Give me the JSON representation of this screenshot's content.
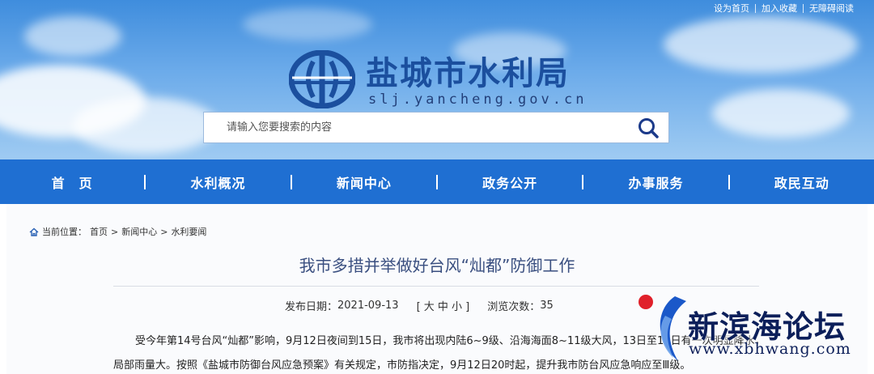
{
  "top_links": [
    "设为首页",
    "加入收藏",
    "无障碍阅读"
  ],
  "site": {
    "title": "盐城市水利局",
    "domain": "slj.yancheng.gov.cn"
  },
  "search": {
    "placeholder": "请输入您要搜索的内容",
    "icon": "search-icon"
  },
  "nav": {
    "items": [
      "首　页",
      "水利概况",
      "新闻中心",
      "政务公开",
      "办事服务",
      "政民互动"
    ]
  },
  "breadcrumb": {
    "prefix": "当前位置：",
    "items": [
      "首页",
      "新闻中心",
      "水利要闻"
    ],
    "separator": ">",
    "icon": "home-icon"
  },
  "article": {
    "title": "我市多措并举做好台风“灿都”防御工作",
    "publish_label": "发布日期：",
    "publish_date": "2021-09-13",
    "font_size_control": "[ 大 中 小 ]",
    "views_label": "浏览次数：",
    "views": "35",
    "paragraph_1": "受今年第14号台风“灿都”影响，9月12日夜间到15日，我市将出现内陆6~9级、沿海海面8~11级大风，13日至15日有一次明显降水，",
    "paragraph_2": "局部雨量大。按照《盐城市防御台风应急预案》有关规定，市防指决定，9月12日20时起，提升我市防台风应急响应至Ⅲ级。"
  },
  "watermark": {
    "name": "新滨海论坛",
    "url": "www.xbhwang.com"
  },
  "colors": {
    "nav_bg": "#1f6fd2",
    "title_blue": "#1b4f9e",
    "article_title": "#3a4f80",
    "watermark_red": "#e0202a",
    "watermark_navy": "#0c1f5a"
  }
}
